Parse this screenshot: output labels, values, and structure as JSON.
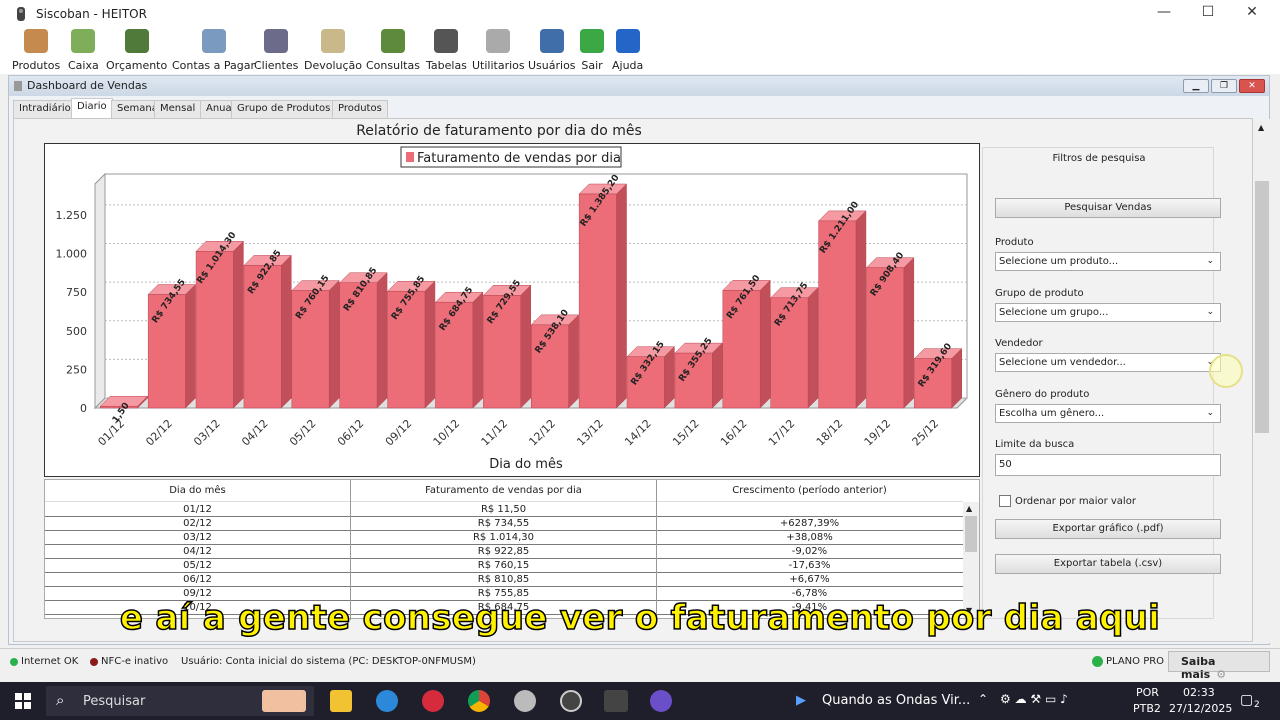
{
  "window": {
    "title": "Siscoban - HEITOR",
    "minimize": "—",
    "maximize": "☐",
    "close": "✕"
  },
  "toolbar": [
    {
      "label": "Produtos",
      "icon": "products-icon",
      "color": "#c58a4d"
    },
    {
      "label": "Caixa",
      "icon": "cart-icon",
      "color": "#7fae5a"
    },
    {
      "label": "Orçamento",
      "icon": "calculator-icon",
      "color": "#4f7a3a"
    },
    {
      "label": "Contas a Pagar",
      "icon": "bills-icon",
      "color": "#7a9bbf"
    },
    {
      "label": "Clientes",
      "icon": "clients-icon",
      "color": "#6c6c8a"
    },
    {
      "label": "Devolução",
      "icon": "return-icon",
      "color": "#c9b98a"
    },
    {
      "label": "Consultas",
      "icon": "search-report-icon",
      "color": "#5e8a3c"
    },
    {
      "label": "Tabelas",
      "icon": "tables-icon",
      "color": "#555555"
    },
    {
      "label": "Utilitarios",
      "icon": "gear-icon",
      "color": "#aaaaaa"
    },
    {
      "label": "Usuários",
      "icon": "user-icon",
      "color": "#3f6ea8"
    },
    {
      "label": "Sair",
      "icon": "exit-icon",
      "color": "#3aa845"
    },
    {
      "label": "Ajuda",
      "icon": "help-icon",
      "color": "#2466c8"
    }
  ],
  "inner": {
    "title": "Dashboard de Vendas",
    "tabs": [
      "Intradiário",
      "Diario",
      "Semanal",
      "Mensal",
      "Anual",
      "Grupo de Produtos",
      "Produtos"
    ],
    "active_tab": 1
  },
  "chart_data": {
    "type": "bar",
    "title": "Relatório de faturamento por dia do mês",
    "xlabel": "Dia do mês",
    "ylabel": "",
    "legend": "top-center",
    "series": [
      {
        "name": "Faturamento de vendas por dia",
        "color": "#ec6d78"
      }
    ],
    "categories": [
      "01/12",
      "02/12",
      "03/12",
      "04/12",
      "05/12",
      "06/12",
      "09/12",
      "10/12",
      "11/12",
      "12/12",
      "13/12",
      "14/12",
      "15/12",
      "16/12",
      "17/12",
      "18/12",
      "19/12",
      "25/12"
    ],
    "values": [
      11.5,
      734.55,
      1014.3,
      922.85,
      760.15,
      810.85,
      755.85,
      684.75,
      729.55,
      538.1,
      1385.2,
      332.15,
      355.25,
      761.5,
      713.75,
      1211.0,
      908.4,
      319.6
    ],
    "labels": [
      "1,50",
      "R$ 734,55",
      "R$ 1.014,30",
      "R$ 922,85",
      "R$ 760,15",
      "R$ 810,85",
      "R$ 755,85",
      "R$ 684,75",
      "R$ 729,55",
      "R$ 538,10",
      "R$ 1.385,20",
      "R$ 332,15",
      "R$ 355,25",
      "R$ 761,50",
      "R$ 713,75",
      "R$ 1.211,00",
      "R$ 908,40",
      "R$ 319,60"
    ],
    "yticks": [
      "0",
      "250",
      "500",
      "750",
      "1.000",
      "1.250"
    ],
    "ytick_values": [
      0,
      250,
      500,
      750,
      1000,
      1250
    ],
    "ylim": [
      0,
      1450
    ],
    "grid": true
  },
  "table": {
    "headers": [
      "Dia do mês",
      "Faturamento de vendas por dia",
      "Crescimento (período anterior)"
    ],
    "rows": [
      [
        "01/12",
        "R$ 11,50",
        ""
      ],
      [
        "02/12",
        "R$ 734,55",
        "+6287,39%"
      ],
      [
        "03/12",
        "R$ 1.014,30",
        "+38,08%"
      ],
      [
        "04/12",
        "R$ 922,85",
        "-9,02%"
      ],
      [
        "05/12",
        "R$ 760,15",
        "-17,63%"
      ],
      [
        "06/12",
        "R$ 810,85",
        "+6,67%"
      ],
      [
        "09/12",
        "R$ 755,85",
        "-6,78%"
      ],
      [
        "10/12",
        "R$ 684,75",
        "-9,41%"
      ]
    ]
  },
  "filters": {
    "title": "Filtros de pesquisa",
    "search_button": "Pesquisar Vendas",
    "produto_label": "Produto",
    "produto_value": "Selecione um produto...",
    "grupo_label": "Grupo de produto",
    "grupo_value": "Selecione um grupo...",
    "vendedor_label": "Vendedor",
    "vendedor_value": "Selecione um vendedor...",
    "genero_label": "Gênero do produto",
    "genero_value": "Escolha um gênero...",
    "limite_label": "Limite da busca",
    "limite_value": "50",
    "ordenar_label": "Ordenar por maior valor",
    "export_pdf": "Exportar gráfico (.pdf)",
    "export_csv": "Exportar tabela (.csv)"
  },
  "subtitle": "e aí a gente consegue ver o faturamento por dia aqui",
  "status": {
    "internet": "Internet OK",
    "internet_color": "#2bb14a",
    "nfce": "NFC-e inativo",
    "nfce_color": "#8b1a1a",
    "user": "Usuário: Conta inicial do sistema (PC: DESKTOP-0NFMUSM)",
    "plan": "PLANO PRO",
    "plan_color": "#2bb14a",
    "saiba": "Saiba mais"
  },
  "taskbar": {
    "search_placeholder": "Pesquisar",
    "media": "Quando as Ondas Vir...",
    "lang1": "POR",
    "lang2": "PTB2",
    "time": "02:33",
    "date": "27/12/2025",
    "notif": "2"
  }
}
